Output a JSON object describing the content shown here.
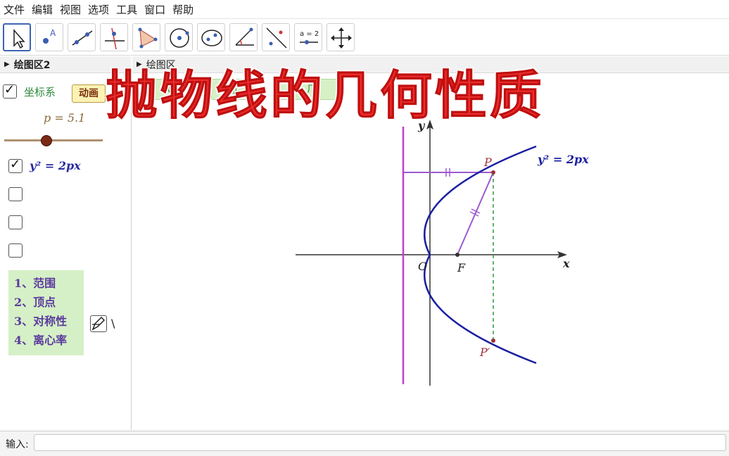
{
  "menu": [
    "文件",
    "编辑",
    "视图",
    "选项",
    "工具",
    "窗口",
    "帮助"
  ],
  "toolbar": {
    "tools": [
      "move-tool",
      "point-tool",
      "line-tool",
      "perpendicular-line-tool",
      "polygon-tool",
      "circle-tool",
      "conic-tool",
      "angle-tool",
      "reflect-tool",
      "slider-tool",
      "move-graphics-tool"
    ],
    "slider_icon_text": "a = 2"
  },
  "panels": {
    "graphics2_title": "绘图区2",
    "graphics_title": "绘图区"
  },
  "left": {
    "axes_label": "坐标系",
    "animate_button": "动画",
    "slider_label": "p = 5.1",
    "slider_value": 0.42,
    "equation_label": "y² = 2px",
    "list": [
      "1、范围",
      "2、顶点",
      "3、对称性",
      "4、离心率"
    ],
    "side_text": "\\"
  },
  "graphics": {
    "background_buttons": [
      "GC",
      "抛",
      "几"
    ],
    "y_axis_label": "y",
    "x_axis_label": "x",
    "origin_label": "O",
    "focus_label": "F",
    "point_p_label": "P",
    "point_p_prime_label": "P′",
    "curve_label": "y² = 2px"
  },
  "overlay_title": "抛物线的几何性质",
  "input": {
    "label": "输入:",
    "value": ""
  },
  "colors": {
    "parabola": "#1a1fa0",
    "directrix": "#c43ccf",
    "segments": "#9a5ad0",
    "dashed": "#2e9a3e",
    "title": "#ee2e2e",
    "point_label": "#a0303a",
    "list_bg": "#d5f0c6",
    "list_text": "#5b3a9e"
  }
}
